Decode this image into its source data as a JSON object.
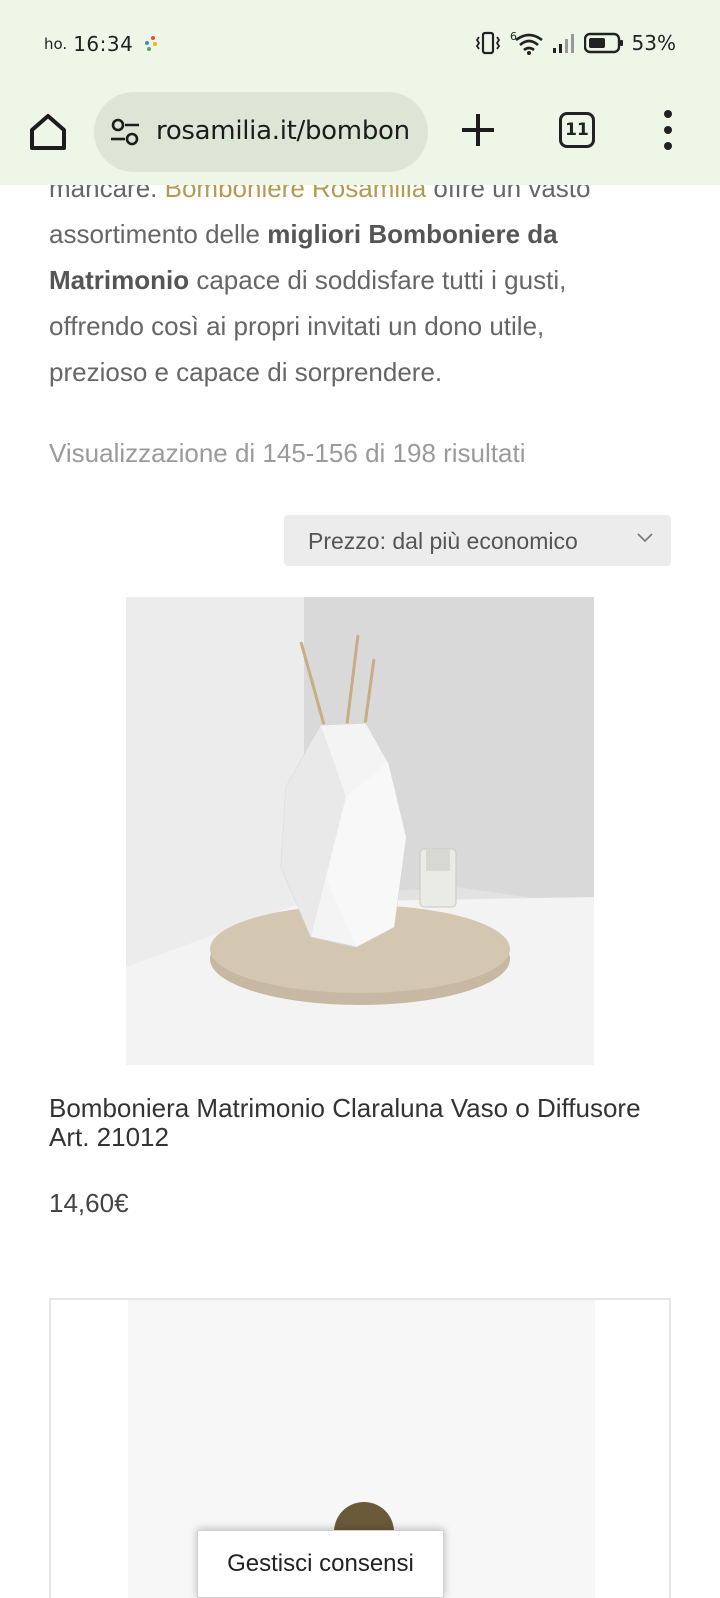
{
  "status_bar": {
    "carrier": "ho.",
    "time": "16:34",
    "battery_percent": "53%",
    "network": "6",
    "icons": [
      "vibrate-icon",
      "wifi-icon",
      "signal-icon",
      "battery-icon"
    ]
  },
  "browser": {
    "url": "rosamilia.it/bombon",
    "tab_count": "11",
    "icons": [
      "home-icon",
      "site-settings-icon",
      "new-tab-icon",
      "tab-switcher-icon",
      "more-menu-icon"
    ]
  },
  "intro": {
    "line1_prefix": "mancare. ",
    "line1_link": "Bomboniere Rosamilia",
    "line1_suffix": " offre un vasto",
    "line2_prefix": "assortimento delle ",
    "line2_bold": "migliori Bomboniere da",
    "line3_bold": "Matrimonio",
    "line3_suffix": " capace di soddisfare tutti i gusti,",
    "line4": "offrendo così ai propri invitati un dono utile,",
    "line5": "prezioso e capace di sorprendere."
  },
  "results": {
    "count_text": "Visualizzazione di 145-156 di 198 risultati"
  },
  "sort": {
    "selected": "Prezzo: dal più economico"
  },
  "products": [
    {
      "title": "Bomboniera Matrimonio Claraluna Vaso o Diffusore Art. 21012",
      "price": "14,60€"
    }
  ],
  "consent": {
    "label": "Gestisci consensi"
  },
  "colors": {
    "browser_bg": "#eef6e8",
    "url_pill": "#dde6d6",
    "link": "#b49a4f",
    "text": "#666666"
  }
}
